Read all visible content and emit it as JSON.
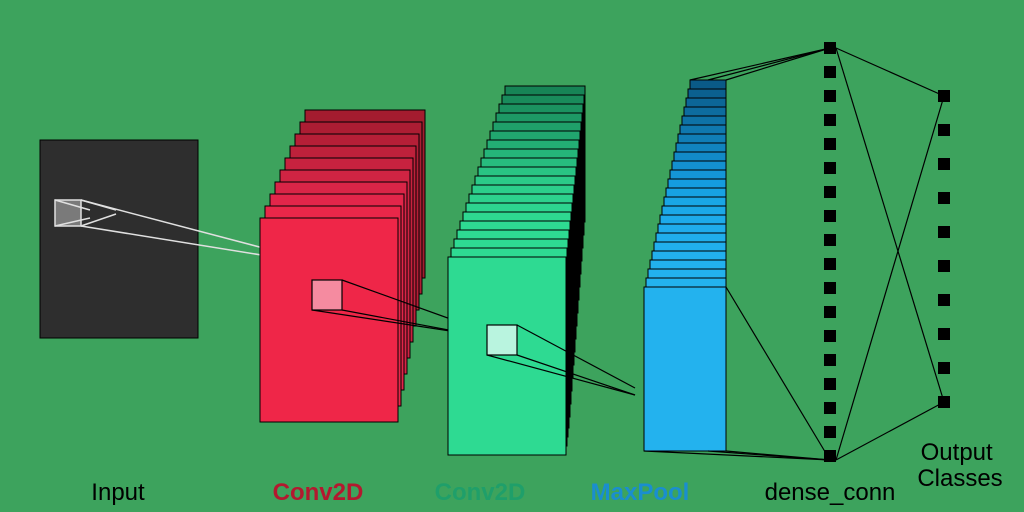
{
  "labels": {
    "input": "Input",
    "conv1": "Conv2D",
    "conv2": "Conv2D",
    "maxpool": "MaxPool",
    "dense": "dense_conn",
    "output": "Output\nClasses"
  },
  "colors": {
    "bg": "#3da35d",
    "input_fill": "#2e2e2e",
    "conv1_front": "#ef2648",
    "conv1_back": "#a31c2f",
    "conv2_front": "#2eda92",
    "conv2_back": "#1f9f6a",
    "maxpool_front": "#23b2ee",
    "maxpool_back": "#0f6aa0",
    "node": "#000000",
    "text_input": "#000000",
    "text_conv1": "#b3192f",
    "text_conv2": "#1f9f6a",
    "text_maxpool": "#1a8ecf",
    "text_dense": "#000000",
    "text_output": "#000000"
  },
  "chart_data": {
    "type": "cnn-architecture-diagram",
    "layers": [
      {
        "name": "Input",
        "kind": "input",
        "planes": 1
      },
      {
        "name": "Conv2D",
        "kind": "conv",
        "planes": 10
      },
      {
        "name": "Conv2D",
        "kind": "conv",
        "planes": 20
      },
      {
        "name": "MaxPool",
        "kind": "pool",
        "planes": 24
      },
      {
        "name": "dense_conn",
        "kind": "dense",
        "units": 18
      },
      {
        "name": "Output Classes",
        "kind": "dense",
        "units": 10
      }
    ]
  }
}
